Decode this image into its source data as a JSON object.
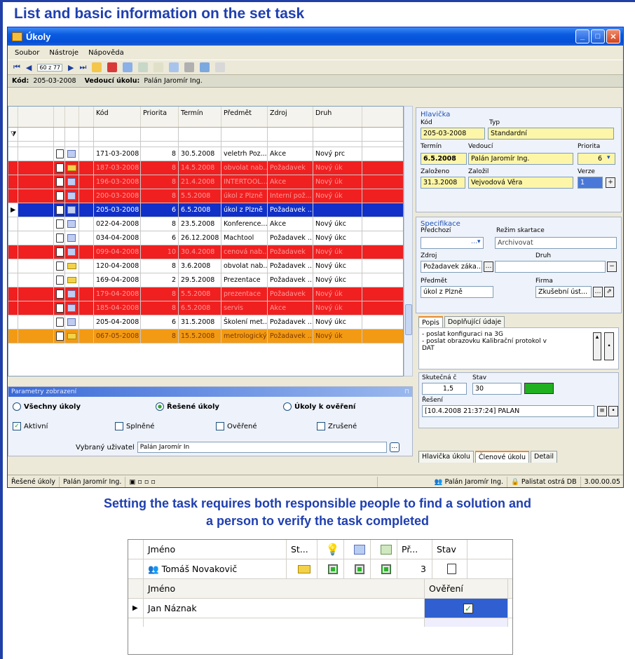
{
  "captions": {
    "top": "List and basic information on the set task",
    "bottom_line1": "Setting the task requires both responsible people to find a solution and",
    "bottom_line2": "a person to verify the task completed"
  },
  "window": {
    "title": "Úkoly",
    "menu": [
      "Soubor",
      "Nástroje",
      "Nápověda"
    ],
    "nav_position": "60 z 77",
    "code_label": "Kód:",
    "code_value": "205-03-2008",
    "leader_label": "Vedoucí úkolu:",
    "leader_value": "Palán Jaromír Ing."
  },
  "grid": {
    "columns": [
      "Kód",
      "Priorita",
      "Termín",
      "Předmět",
      "Zdroj",
      "Druh"
    ],
    "rows": [
      {
        "style": "normal",
        "kod": "171-03-2008",
        "priorita": "8",
        "termin": "30.5.2008",
        "predmet": "veletrh Poz...",
        "zdroj": "Akce",
        "druh": "Nový prc"
      },
      {
        "style": "red",
        "kod": "187-03-2008",
        "priorita": "8",
        "termin": "14.5.2008",
        "predmet": "obvolat nab...",
        "zdroj": "Požadavek",
        "druh": "Nový úk"
      },
      {
        "style": "red",
        "kod": "196-03-2008",
        "priorita": "8",
        "termin": "21.4.2008",
        "predmet": "INTERTOOL...",
        "zdroj": "Akce",
        "druh": "Nový úk"
      },
      {
        "style": "red",
        "kod": "200-03-2008",
        "priorita": "8",
        "termin": "5.5.2008",
        "predmet": "úkol z Plzně",
        "zdroj": "Interní pož...",
        "druh": "Nový úk"
      },
      {
        "style": "blue",
        "kod": "205-03-2008",
        "priorita": "6",
        "termin": "6.5.2008",
        "predmet": "úkol z Plzně",
        "zdroj": "Požadavek ...",
        "druh": ""
      },
      {
        "style": "normal",
        "kod": "022-04-2008",
        "priorita": "8",
        "termin": "23.5.2008",
        "predmet": "Konference...",
        "zdroj": "Akce",
        "druh": "Nový úkc"
      },
      {
        "style": "normal",
        "kod": "034-04-2008",
        "priorita": "6",
        "termin": "26.12.2008",
        "predmet": "Machtool",
        "zdroj": "Požadavek ...",
        "druh": "Nový úkc"
      },
      {
        "style": "red",
        "kod": "099-04-2008",
        "priorita": "10",
        "termin": "30.4.2008",
        "predmet": "cenová nab...",
        "zdroj": "Požadavek",
        "druh": "Nový úk"
      },
      {
        "style": "normal",
        "kod": "120-04-2008",
        "priorita": "8",
        "termin": "3.6.2008",
        "predmet": "obvolat nab...",
        "zdroj": "Požadavek ...",
        "druh": "Nový úkc"
      },
      {
        "style": "normal",
        "kod": "169-04-2008",
        "priorita": "2",
        "termin": "29.5.2008",
        "predmet": "Prezentace",
        "zdroj": "Požadavek ...",
        "druh": "Nový úkc"
      },
      {
        "style": "red",
        "kod": "179-04-2008",
        "priorita": "8",
        "termin": "5.5.2008",
        "predmet": "prezentace",
        "zdroj": "Požadavek",
        "druh": "Nový úk"
      },
      {
        "style": "red",
        "kod": "185-04-2008",
        "priorita": "8",
        "termin": "6.5.2008",
        "predmet": "servis",
        "zdroj": "Akce",
        "druh": "Nový úk"
      },
      {
        "style": "normal",
        "kod": "205-04-2008",
        "priorita": "6",
        "termin": "31.5.2008",
        "predmet": "Školení met...",
        "zdroj": "Požadavek ...",
        "druh": "Nový úkc"
      },
      {
        "style": "orange",
        "kod": "067-05-2008",
        "priorita": "8",
        "termin": "15.5.2008",
        "predmet": "metrologický",
        "zdroj": "Požadavek ...",
        "druh": "Nový úk"
      }
    ]
  },
  "params": {
    "title": "Parametry zobrazení",
    "radio_all": "Všechny úkoly",
    "radio_solved": "Řešené úkoly",
    "radio_verify": "Úkoly k ověření",
    "chk_active": "Aktivní",
    "chk_done": "Splněné",
    "chk_verified": "Ověřené",
    "chk_cancelled": "Zrušené",
    "user_label": "Vybraný uživatel",
    "user_value": "Palán Jaromír In"
  },
  "detail": {
    "header_title": "Hlavička",
    "kod_label": "Kód",
    "kod": "205-03-2008",
    "typ_label": "Typ",
    "typ": "Standardní",
    "termin_label": "Termín",
    "termin": "6.5.2008",
    "vedouci_label": "Vedoucí",
    "vedouci": "Palán Jaromír Ing.",
    "priorita_label": "Priorita",
    "priorita": "6",
    "zalozeno_label": "Založeno",
    "zalozeno": "31.3.2008",
    "zalozil_label": "Založil",
    "zalozil": "Vejvodová Věra",
    "verze_label": "Verze",
    "verze": "1",
    "spec_title": "Specifikace",
    "predchozi_label": "Předchozí",
    "rezim_label": "Režim skartace",
    "rezim": "Archivovat",
    "zdroj_label": "Zdroj",
    "zdroj": "Požadavek záka...",
    "druh_label": "Druh",
    "predmet_label": "Předmět",
    "predmet": "úkol z Plzně",
    "firma_label": "Firma",
    "firma": "Zkušební úst...",
    "tab_popis": "Popis",
    "tab_dopl": "Doplňující údaje",
    "popis_line1": "- poslat konfiguraci na 3G",
    "popis_line2": "- poslat obrazovku Kalibrační protokol v",
    "popis_line3": "DAT",
    "skutecna_label": "Skutečná č",
    "skutecna": "1,5",
    "stav_label": "Stav",
    "stav": "30",
    "reseni_label": "Řešení",
    "reseni": "[10.4.2008 21:37:24] PALAN",
    "btab1": "Hlavička úkolu",
    "btab2": "Členové úkolu",
    "btab3": "Detail"
  },
  "status": {
    "left1": "Řešené úkoly",
    "left2": "Palán Jaromír Ing.",
    "user": "Palán Jaromír Ing.",
    "db": "Palistat ostrá DB",
    "version": "3.00.00.05"
  },
  "members": {
    "h_jmeno": "Jméno",
    "h_st": "St...",
    "h_pr": "Př...",
    "h_stav": "Stav",
    "solver": "Tomáš Novakovič",
    "solver_pr": "3",
    "h2_jmeno": "Jméno",
    "h2_overeni": "Ověření",
    "verifier": "Jan Náznak"
  },
  "colors": {
    "red_row": "#f02020",
    "selected_row": "#1030c8",
    "orange_row": "#f39a14",
    "accent_blue": "#1f3fb0",
    "field_yellow": "#fdf6a8"
  }
}
